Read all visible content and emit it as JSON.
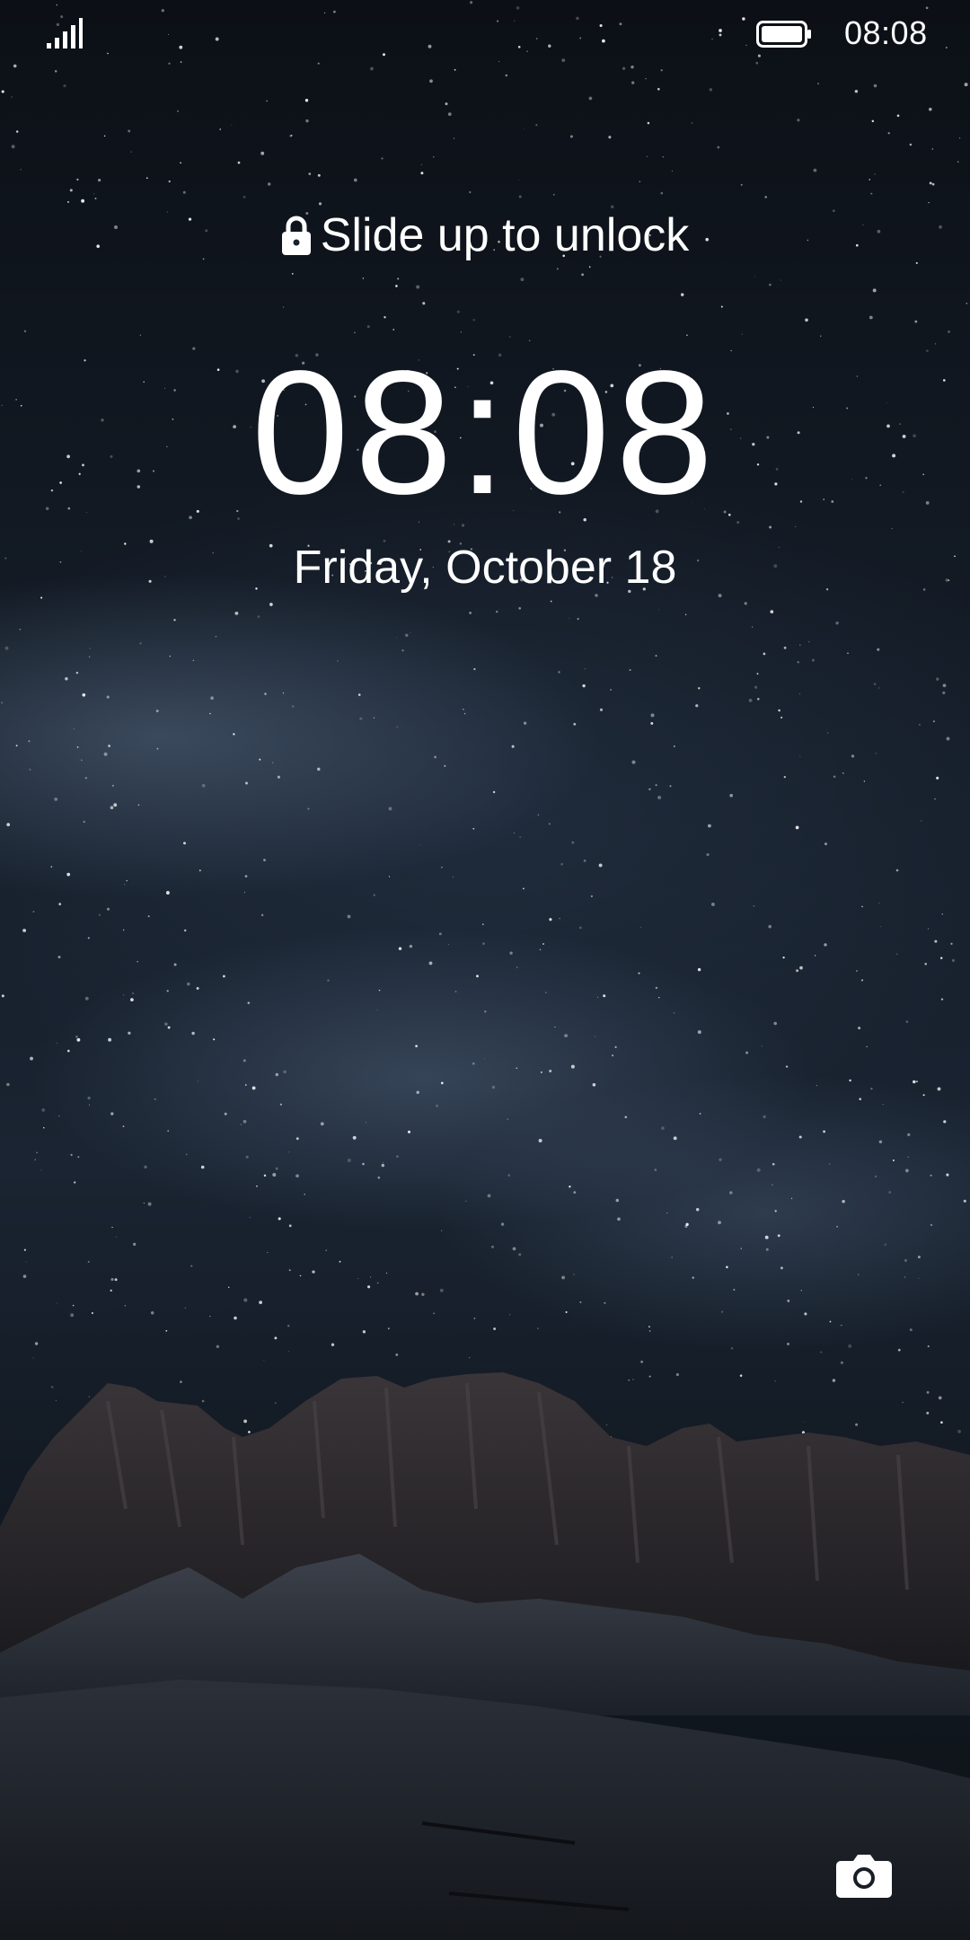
{
  "status_bar": {
    "time": "08:08",
    "signal_icon": "signal-bars-icon",
    "battery_icon": "battery-full-icon"
  },
  "lock_screen": {
    "hint_text": "Slide up to unlock",
    "lock_icon": "lock-icon",
    "clock": "08:08",
    "date": "Friday, October 18",
    "camera_icon": "camera-icon"
  },
  "colors": {
    "text": "#ffffff",
    "sky_dark": "#0c1016",
    "sky_mid": "#1a2432"
  }
}
